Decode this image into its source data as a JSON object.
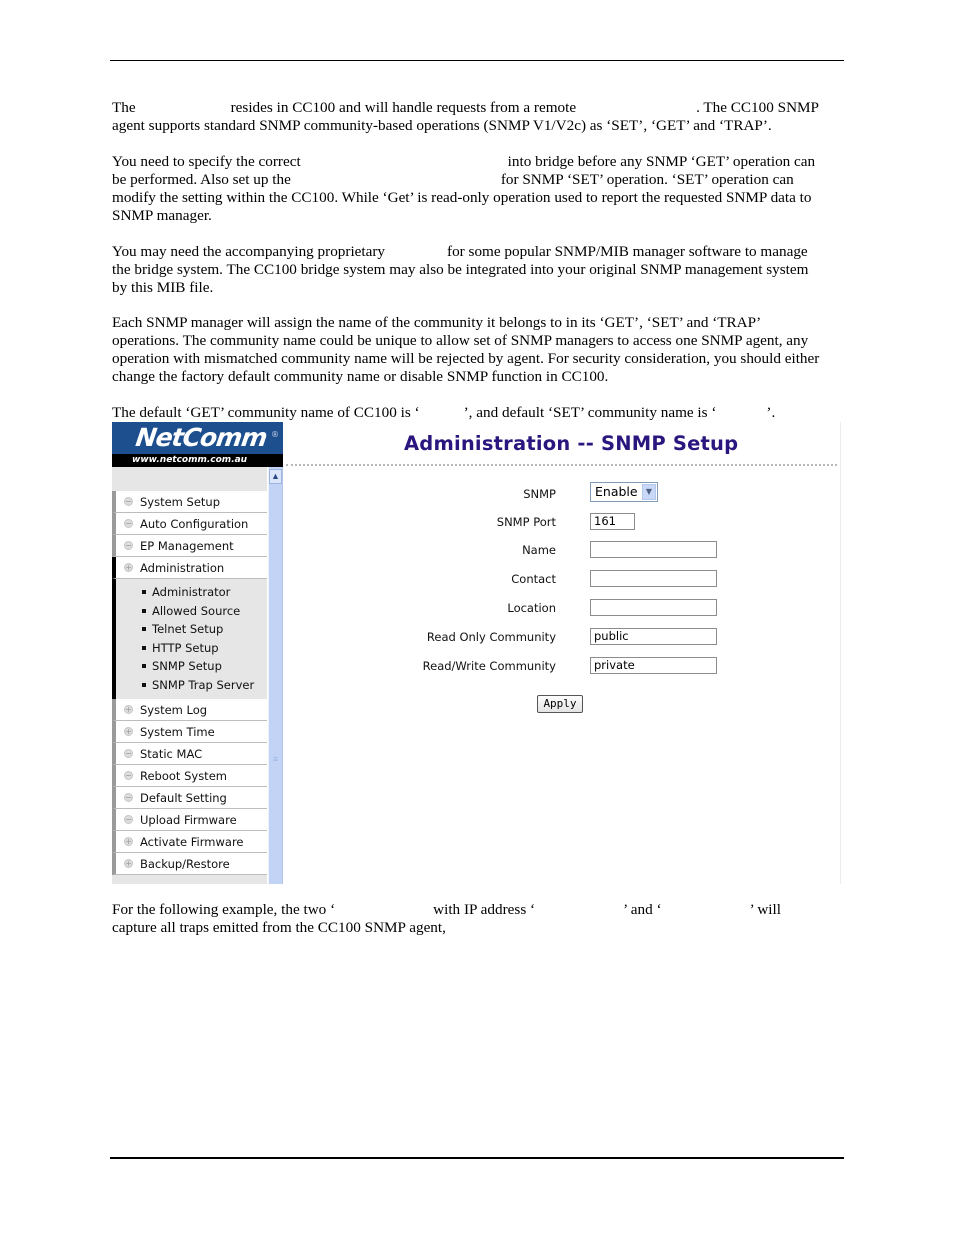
{
  "document": {
    "paragraphs": [
      {
        "lines": [
          [
            "The",
            "resides in CC100 and will handle requests from a remote",
            ". The CC100 SNMP"
          ],
          [
            "agent supports standard SNMP community-based operations (SNMP V1/V2c) as ‘SET’, ‘GET’ and ‘TRAP’."
          ]
        ]
      },
      {
        "lines": [
          [
            "You need to specify the correct",
            "into bridge before any SNMP ‘GET’ operation can"
          ],
          [
            "be performed. Also set up the",
            "for SNMP ‘SET’ operation. ‘SET’ operation can"
          ],
          [
            "modify the setting within the CC100. While ‘Get’ is read-only operation used to report the requested SNMP data to"
          ],
          [
            "SNMP manager."
          ]
        ]
      },
      {
        "lines": [
          [
            "You may need the accompanying proprietary",
            "for some popular SNMP/MIB manager software to manage"
          ],
          [
            "the bridge system. The CC100 bridge system may also be integrated into your original SNMP management system"
          ],
          [
            "by this MIB file."
          ]
        ]
      },
      {
        "lines": [
          [
            "Each SNMP manager will assign the name of the community it belongs to in its ‘GET’, ‘SET’ and ‘TRAP’"
          ],
          [
            "operations. The community name could be unique to allow set of SNMP managers to access one SNMP agent, any"
          ],
          [
            "operation with mismatched community name will be rejected by agent. For security consideration, you should either"
          ],
          [
            "change the factory default community name or disable SNMP function in CC100."
          ]
        ]
      },
      {
        "lines": [
          [
            "The default ‘GET’ community name of CC100 is ‘",
            "’, and default ‘SET’ community name is ‘",
            "’."
          ]
        ]
      },
      {
        "lines": [
          [
            "For the following example, the two ‘",
            "with IP address ‘",
            "’ and ‘",
            "’ will"
          ],
          [
            "capture all traps emitted from the CC100 SNMP agent,"
          ]
        ]
      }
    ]
  },
  "screenshot": {
    "logo": {
      "brand": "NetComm",
      "registered": "®",
      "url": "www.netcomm.com.au"
    },
    "page_title": "Administration -- SNMP Setup",
    "menu_top": [
      {
        "label": "System Setup",
        "icon": "minus"
      },
      {
        "label": "Auto Configuration",
        "icon": "minus"
      },
      {
        "label": "EP Management",
        "icon": "minus"
      },
      {
        "label": "Administration",
        "icon": "plus"
      }
    ],
    "submenu": [
      {
        "label": "Administrator"
      },
      {
        "label": "Allowed Source"
      },
      {
        "label": "Telnet Setup"
      },
      {
        "label": "HTTP Setup"
      },
      {
        "label": "SNMP Setup"
      },
      {
        "label": "SNMP Trap Server"
      }
    ],
    "menu_bottom": [
      {
        "label": "System Log",
        "icon": "plus"
      },
      {
        "label": "System Time",
        "icon": "plus"
      },
      {
        "label": "Static MAC",
        "icon": "minus"
      },
      {
        "label": "Reboot System",
        "icon": "minus"
      },
      {
        "label": "Default Setting",
        "icon": "minus"
      },
      {
        "label": "Upload Firmware",
        "icon": "minus"
      },
      {
        "label": "Activate Firmware",
        "icon": "plus"
      },
      {
        "label": "Backup/Restore",
        "icon": "plus"
      }
    ],
    "form": {
      "snmp_label": "SNMP",
      "snmp_value": "Enable",
      "port_label": "SNMP Port",
      "port_value": "161",
      "name_label": "Name",
      "name_value": "",
      "contact_label": "Contact",
      "contact_value": "",
      "location_label": "Location",
      "location_value": "",
      "ro_label": "Read Only Community",
      "ro_value": "public",
      "rw_label": "Read/Write Community",
      "rw_value": "private",
      "apply_label": "Apply"
    },
    "colors": {
      "title": "#2b1680",
      "scrollbar": "#c2d3f6",
      "logo_bg": "#1d4f8f"
    }
  }
}
